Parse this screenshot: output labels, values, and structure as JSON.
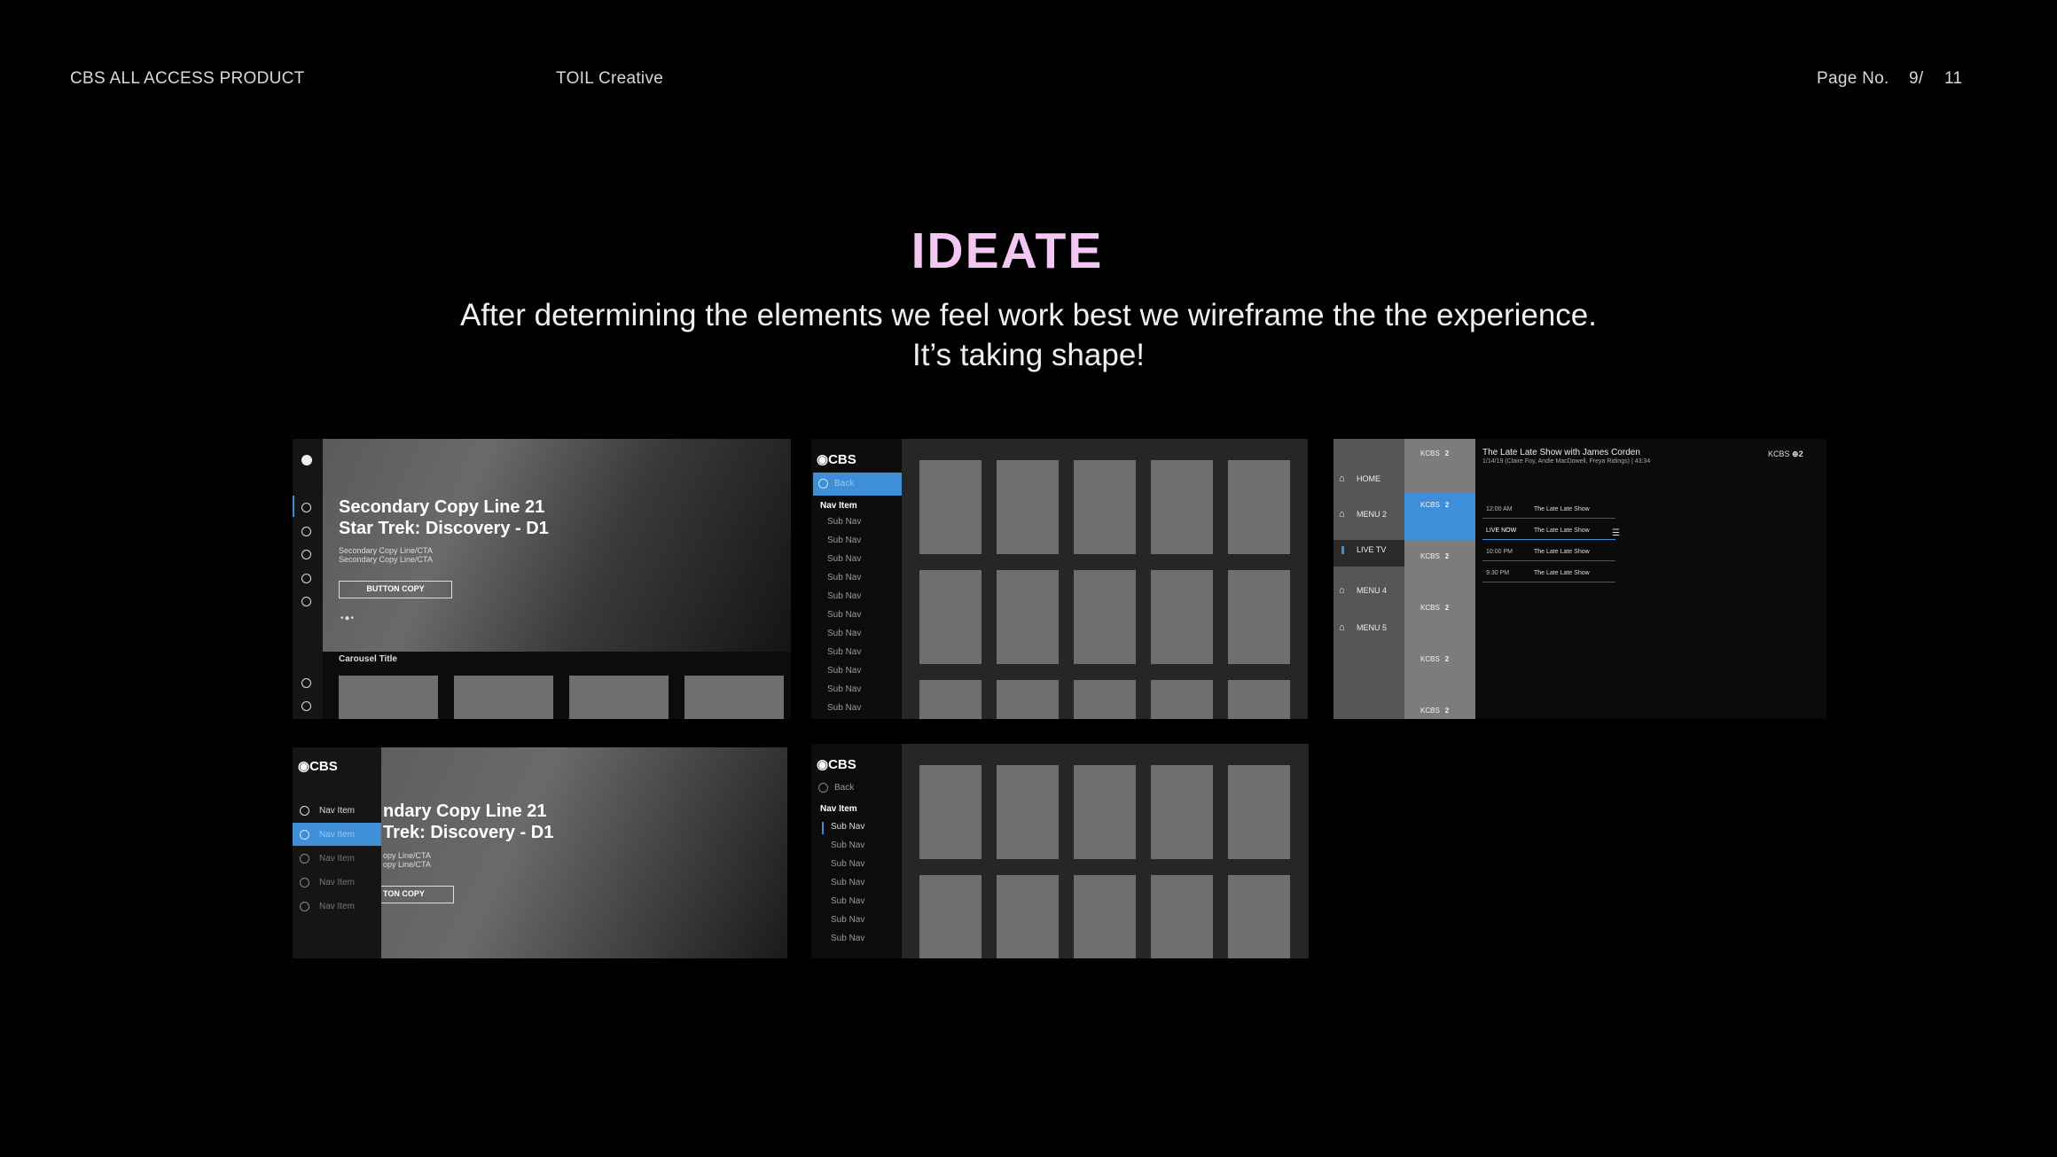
{
  "header": {
    "left": "CBS ALL ACCESS PRODUCT",
    "center": "TOIL Creative",
    "page_label": "Page No.",
    "page_current": "9/",
    "page_total": "11"
  },
  "title": "IDEATE",
  "subtitle_line1": "After determining the elements we feel work best we wireframe the the experience.",
  "subtitle_line2": "It’s taking shape!",
  "wireframe1": {
    "hero_line1": "Secondary Copy Line 21",
    "hero_line2": "Star Trek: Discovery - D1",
    "cta1": "Secondary Copy Line/CTA",
    "cta2": "Secondary Copy Line/CTA",
    "button": "BUTTON COPY",
    "carousel_title": "Carousel Title"
  },
  "wireframe2": {
    "logo": "CBS",
    "back": "Back",
    "nav_item": "Nav Item",
    "sub_nav": "Sub Nav"
  },
  "wireframe3": {
    "menu": [
      "HOME",
      "MENU 2",
      "LIVE TV",
      "MENU 4",
      "MENU 5"
    ],
    "channel": "KCBS",
    "channel_num": "2",
    "show_title": "The Late Late Show with James Corden",
    "show_meta": "1/14/19 (Claire Foy, Andie MacDowell, Freya Ridings)  |  43:34",
    "schedule": [
      {
        "time": "12:00 AM",
        "show": "The Late Late Show"
      },
      {
        "time": "LIVE NOW",
        "show": "The Late Late Show"
      },
      {
        "time": "10:00 PM",
        "show": "The Late Late Show"
      },
      {
        "time": "9:30 PM",
        "show": "The Late Late Show"
      }
    ]
  },
  "wireframe4": {
    "logo": "CBS",
    "nav_item": "Nav Item",
    "hero_line1": "ndary Copy Line 21",
    "hero_line2": "Trek: Discovery - D1",
    "cta1": "opy Line/CTA",
    "cta2": "opy Line/CTA",
    "button": "TON COPY"
  },
  "wireframe5": {
    "logo": "CBS",
    "back": "Back",
    "nav_item": "Nav Item",
    "sub_nav": "Sub Nav"
  },
  "colors": {
    "title": "#f3c7f1",
    "highlight": "#3e8fd8",
    "tile": "#6f6f6f"
  }
}
